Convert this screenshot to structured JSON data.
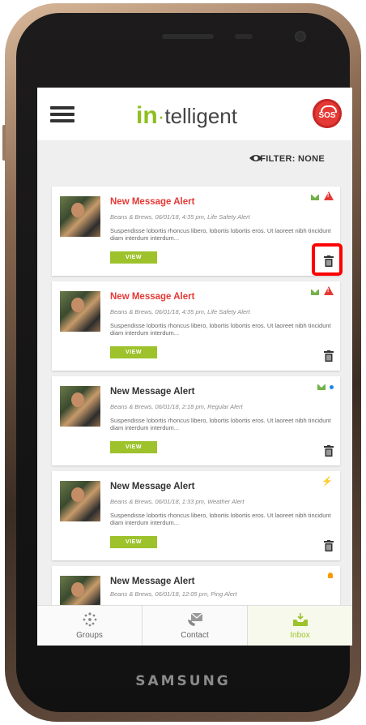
{
  "device": {
    "brand": "SAMSUNG"
  },
  "header": {
    "logo_in": "in",
    "logo_dot": "·",
    "logo_rest": "telligent",
    "sos_label": "SOS"
  },
  "filter": {
    "label": "FILTER: NONE"
  },
  "messages": [
    {
      "title": "New Message Alert",
      "meta": "Beans & Brews, 06/01/18, 4:35 pm, Life Safety Alert",
      "body": "Suspendisse lobortis rhoncus libero, lobortis lobortis eros. Ut laoreet nibh tincidunt diam interdum interdum...",
      "button": "VIEW",
      "unread": true,
      "indicators": [
        "envelope-icon",
        "warning-icon"
      ]
    },
    {
      "title": "New Message Alert",
      "meta": "Beans & Brews, 06/01/18, 4:35 pm, Life Safety Alert",
      "body": "Suspendisse lobortis rhoncus libero, lobortis lobortis eros. Ut laoreet nibh tincidunt diam interdum interdum...",
      "button": "VIEW",
      "unread": true,
      "indicators": [
        "envelope-icon",
        "warning-icon"
      ]
    },
    {
      "title": "New Message Alert",
      "meta": "Beans & Brews, 06/01/18, 2:18 pm, Regular Alert",
      "body": "Suspendisse lobortis rhoncus libero, lobortis lobortis eros. Ut laoreet nibh tincidunt diam interdum interdum...",
      "button": "VIEW",
      "unread": false,
      "indicators": [
        "envelope-icon",
        "blue-dot-icon"
      ]
    },
    {
      "title": "New Message Alert",
      "meta": "Beans & Brews, 06/01/18, 1:33 pm, Weather Alert",
      "body": "Suspendisse lobortis rhoncus libero, lobortis lobortis eros. Ut laoreet nibh tincidunt diam interdum interdum...",
      "button": "VIEW",
      "unread": false,
      "indicators": [
        "lightning-icon"
      ]
    },
    {
      "title": "New Message Alert",
      "meta": "Beans & Brews, 06/01/18, 12:05 pm, Ping Alert",
      "unread": false,
      "indicators": [
        "bell-icon"
      ]
    }
  ],
  "bottom_nav": [
    {
      "label": "Groups",
      "icon": "groups-icon",
      "active": false
    },
    {
      "label": "Contact",
      "icon": "contact-icon",
      "active": false
    },
    {
      "label": "Inbox",
      "icon": "inbox-icon",
      "active": true
    }
  ],
  "colors": {
    "accent": "#9dc22b",
    "alert": "#e53935",
    "highlight": "#ff0000"
  }
}
